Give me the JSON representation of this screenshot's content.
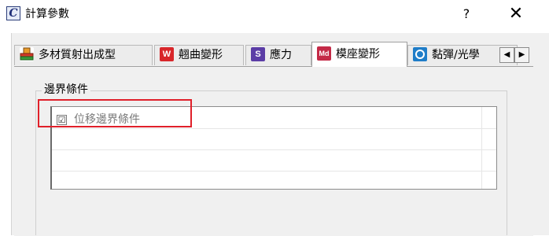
{
  "window": {
    "icon_letter": "C",
    "title": "計算參數",
    "help_label": "?",
    "close_label": "✕"
  },
  "tabs": [
    {
      "label": "多材質射出成型",
      "icon": "mold-icon",
      "active": false
    },
    {
      "label": "翹曲變形",
      "icon": "w-icon",
      "icon_text": "W",
      "active": false
    },
    {
      "label": "應力",
      "icon": "s-icon",
      "icon_text": "S",
      "active": false
    },
    {
      "label": "模座變形",
      "icon": "md-icon",
      "icon_text": "Md",
      "active": true
    },
    {
      "label": "黏彈/光學",
      "icon": "o-icon",
      "icon_text": "",
      "active": false
    }
  ],
  "tab_scroll": {
    "left": "◀",
    "right": "▶"
  },
  "group": {
    "label": "邊界條件"
  },
  "list": {
    "items": [
      {
        "label": "位移邊界條件",
        "checked": true,
        "check_mark": "☑"
      }
    ]
  },
  "colors": {
    "highlight": "#e0202a",
    "tab_active_bg": "#ffffff",
    "dialog_bg": "#f0f0f0"
  }
}
